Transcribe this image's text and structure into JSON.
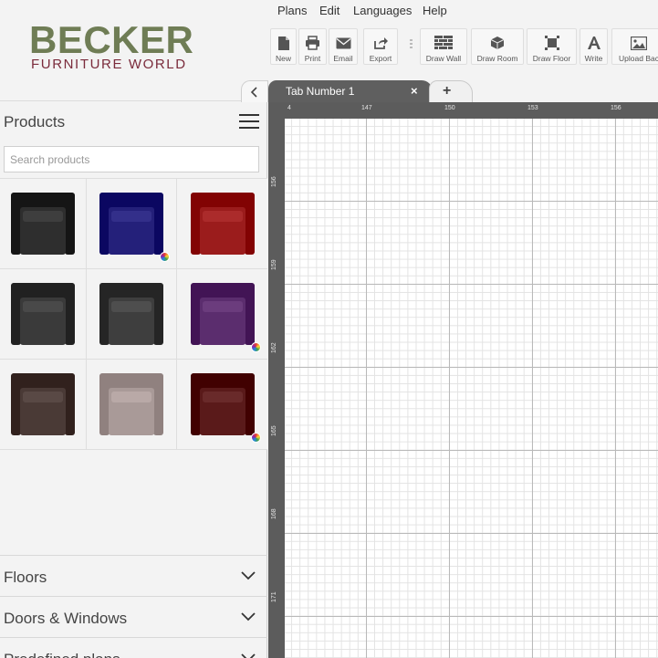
{
  "logo": {
    "line1": "BECKER",
    "line2": "FURNITURE WORLD"
  },
  "sidebar": {
    "collapse_icon": "chevron-left-icon",
    "products_title": "Products",
    "menu_icon": "hamburger-menu-icon",
    "search_placeholder": "Search products",
    "products": [
      {
        "name": "black-leather-armchair",
        "color": "#2e2e2e",
        "has_colors": false
      },
      {
        "name": "navy-recliner-chair",
        "color": "#24207a",
        "has_colors": true
      },
      {
        "name": "red-leather-armchair",
        "color": "#9b1c1c",
        "has_colors": false
      },
      {
        "name": "black-swivel-chair",
        "color": "#3a3a3a",
        "has_colors": false
      },
      {
        "name": "black-club-chair",
        "color": "#3e3e3e",
        "has_colors": false
      },
      {
        "name": "purple-armchair",
        "color": "#5b2d6e",
        "has_colors": true
      },
      {
        "name": "brown-leather-armchair",
        "color": "#4a3a36",
        "has_colors": false
      },
      {
        "name": "taupe-tufted-chair",
        "color": "#a99a98",
        "has_colors": false
      },
      {
        "name": "burgundy-accent-chair",
        "color": "#5a1a1a",
        "has_colors": true
      }
    ],
    "sections": [
      {
        "label": "Floors"
      },
      {
        "label": "Doors & Windows"
      },
      {
        "label": "Predefined plans"
      }
    ]
  },
  "menubar": {
    "items": [
      "Plans",
      "Edit",
      "Languages",
      "Help"
    ]
  },
  "toolbar": {
    "buttons": [
      {
        "label": "New",
        "icon": "new-file-icon"
      },
      {
        "label": "Print",
        "icon": "print-icon"
      },
      {
        "label": "Email",
        "icon": "email-icon"
      },
      {
        "label": "Export",
        "icon": "export-icon"
      },
      {
        "label": "Draw Wall",
        "icon": "brick-wall-icon"
      },
      {
        "label": "Draw Room",
        "icon": "cube-icon"
      },
      {
        "label": "Draw Floor",
        "icon": "floor-icon"
      },
      {
        "label": "Write",
        "icon": "text-icon"
      },
      {
        "label": "Upload Bac",
        "icon": "image-icon"
      }
    ]
  },
  "tabs": {
    "active_label": "Tab Number 1",
    "close_symbol": "×",
    "add_symbol": "+"
  },
  "canvas": {
    "ruler_top_labels": [
      "4",
      "147",
      "150",
      "153",
      "156"
    ],
    "ruler_left_labels": [
      "156",
      "159",
      "162",
      "165",
      "168",
      "171"
    ]
  }
}
